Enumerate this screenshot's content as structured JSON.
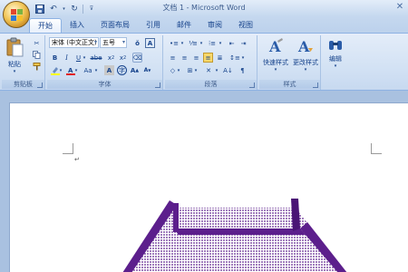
{
  "window": {
    "title": "文档 1 - Microsoft Word"
  },
  "tabs": [
    {
      "label": "开始"
    },
    {
      "label": "插入"
    },
    {
      "label": "页面布局"
    },
    {
      "label": "引用"
    },
    {
      "label": "邮件"
    },
    {
      "label": "审阅"
    },
    {
      "label": "视图"
    }
  ],
  "ribbon": {
    "clipboard": {
      "paste_label": "粘贴",
      "group_label": "剪贴板"
    },
    "font": {
      "font_name": "宋体 (中文正文)",
      "font_size": "五号",
      "group_label": "字体"
    },
    "paragraph": {
      "group_label": "段落"
    },
    "styles": {
      "quick_styles_label": "快速样式",
      "change_styles_label": "更改样式",
      "group_label": "样式"
    },
    "editing": {
      "edit_label": "编辑"
    }
  },
  "colors": {
    "accent": "#15428b",
    "shape_purple": "#5c1f8c",
    "highlight_yellow": "#ffff00",
    "font_red": "#e02020"
  }
}
